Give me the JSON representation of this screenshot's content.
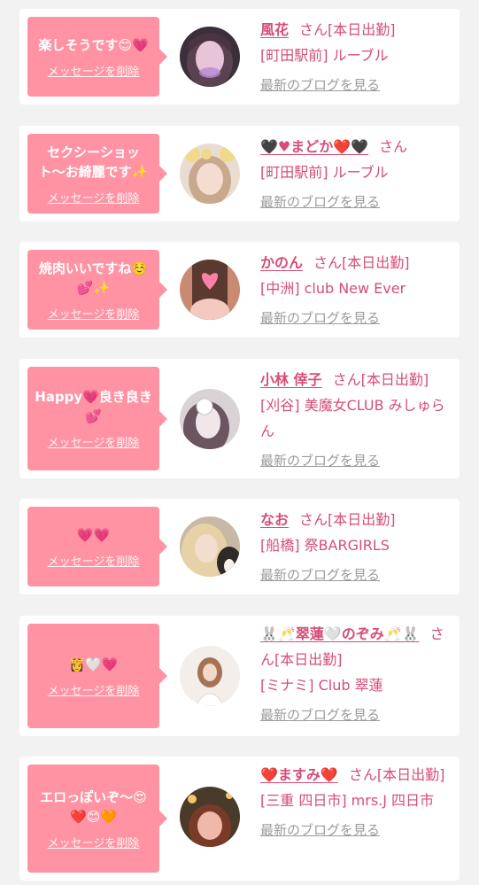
{
  "common": {
    "delete_label": "メッセージを削除",
    "blog_label": "最新のブログを見る",
    "honorific": "さん",
    "bubble_color": "#ff93a3",
    "name_color": "#d64d76",
    "link_color": "#9b9b9b"
  },
  "cards": [
    {
      "message": "楽しそうです😊💗",
      "name": "風花",
      "status": "[本日出勤]",
      "shop": "[町田駅前] ルーブル"
    },
    {
      "message": "セクシーショット〜お綺麗です✨",
      "name": "🖤♥まどか❤️🖤",
      "status": "",
      "shop": "[町田駅前] ルーブル"
    },
    {
      "message": "焼肉いいですね☺️💕✨",
      "name": "かのん",
      "status": "[本日出勤]",
      "shop": "[中洲] club New Ever"
    },
    {
      "message": "Happy💗良き良き💕",
      "name": "小林 倖子",
      "status": "[本日出勤]",
      "shop": "[刈谷] 美魔女CLUB みしゅらん"
    },
    {
      "message": "💗💗",
      "name": "なお",
      "status": "[本日出勤]",
      "shop": "[船橋] 祭BARGIRLS"
    },
    {
      "message": "👸🤍💗",
      "name": "🐰🥂翠蓮🤍のぞみ🥂🐰",
      "status": "[本日出勤]",
      "shop": "[ミナミ] Club 翠蓮"
    },
    {
      "message": "エロっぽいぞ〜😍❤️😊🧡",
      "name": "❤️ますみ❤️",
      "status": "[本日出勤]",
      "shop": "[三重 四日市] mrs.J 四日市"
    }
  ]
}
